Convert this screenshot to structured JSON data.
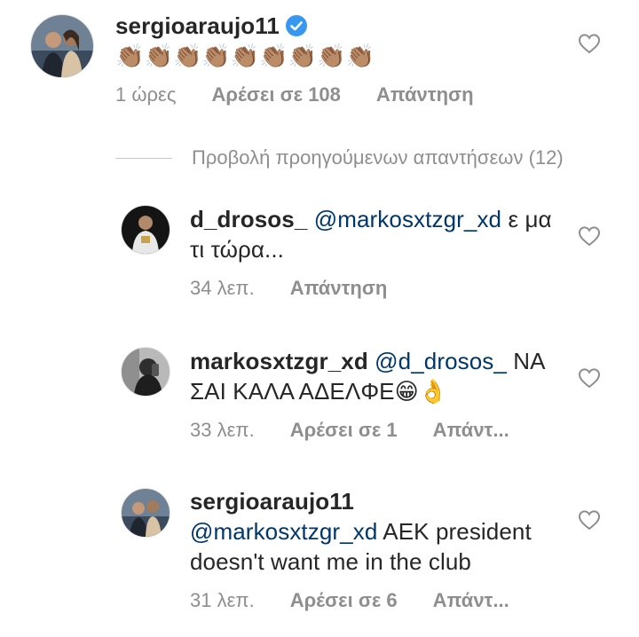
{
  "comments": [
    {
      "username": "sergioaraujo11",
      "verified": true,
      "mention": "",
      "text": "👏🏽👏🏽👏🏽👏🏽👏🏽👏🏽👏🏽👏🏽👏🏽",
      "time": "1 ώρες",
      "likes": "Αρέσει σε 108",
      "reply": "Απάντηση"
    },
    {
      "username": "d_drosos_",
      "mention": "@markosxtzgr_xd",
      "text": "ε μα τι τώρα...",
      "time": "34 λεπ.",
      "likes": "",
      "reply": "Απάντηση"
    },
    {
      "username": "markosxtzgr_xd",
      "mention": "@d_drosos_",
      "text": "ΝΑ ΣΑΙ ΚΑΛΑ ΑΔΕΛΦΕ😁👌",
      "time": "33 λεπ.",
      "likes": "Αρέσει σε 1",
      "reply": "Απάντ..."
    },
    {
      "username": "sergioaraujo11",
      "mention": "@markosxtzgr_xd",
      "text": "AEK president doesn't want me in the club",
      "time": "31 λεπ.",
      "likes": "Αρέσει σε 6",
      "reply": "Απάντ..."
    }
  ],
  "view_previous": "Προβολή προηγούμενων απαντήσεων (12)",
  "colors": {
    "text": "#262626",
    "muted": "#8e8e8e",
    "mention": "#00376b",
    "verified": "#3897f0"
  },
  "icons": [
    "heart-outline-icon",
    "verified-badge-icon"
  ]
}
